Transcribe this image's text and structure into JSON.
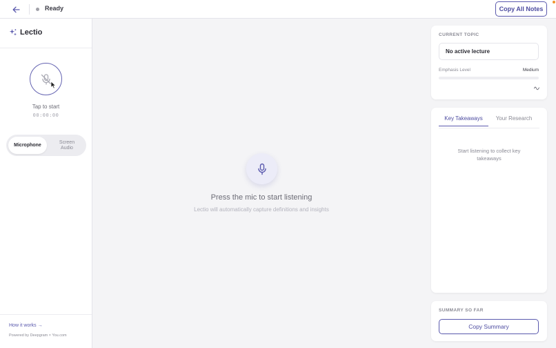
{
  "topbar": {
    "back_icon": "arrow-left-icon",
    "status": "Ready",
    "copy_all_label": "Copy All Notes"
  },
  "sidebar": {
    "brand": "Lectio",
    "brand_icon": "sparkle-icon",
    "mic_icon": "mic-off-icon",
    "tap_text": "Tap to start",
    "timer": "00:00:00",
    "sources": [
      {
        "label": "Microphone",
        "selected": true
      },
      {
        "label": "Screen Audio",
        "selected": false
      }
    ],
    "how_link": "How it works →",
    "powered_by": "Powered by Deepgram × You.com"
  },
  "main": {
    "mic_icon": "mic-icon",
    "title": "Press the mic to start listening",
    "subtitle": "Lectio will automatically capture definitions and insights"
  },
  "topic_panel": {
    "label": "CURRENT TOPIC",
    "topic": "No active lecture",
    "emphasis_label": "Emphasis Level",
    "emphasis_value": "Medium",
    "emphasis_fraction": 0.0,
    "wave_icon": "waveform-icon"
  },
  "takeaways_panel": {
    "tabs": [
      {
        "label": "Key Takeaways",
        "active": true
      },
      {
        "label": "Your Research",
        "active": false
      }
    ],
    "empty_message": "Start listening to collect key takeaways"
  },
  "summary_panel": {
    "label": "SUMMARY SO FAR",
    "copy_label": "Copy Summary"
  },
  "colors": {
    "accent": "#5a59ad",
    "background": "#f4f4f6",
    "status_dot": "#a0a0a8"
  }
}
